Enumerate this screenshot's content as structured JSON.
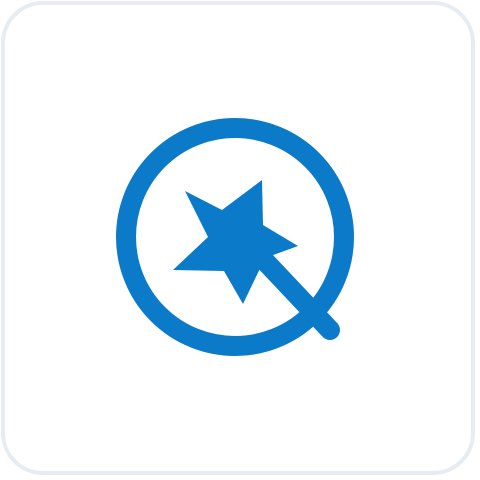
{
  "app_icon": {
    "name": "magic-search-app-icon",
    "icon": "magnifier-magic-wand-icon",
    "colors": {
      "primary": "#0b7ac8",
      "tile_background": "#ffffff",
      "tile_border": "#e7ebf3"
    }
  }
}
